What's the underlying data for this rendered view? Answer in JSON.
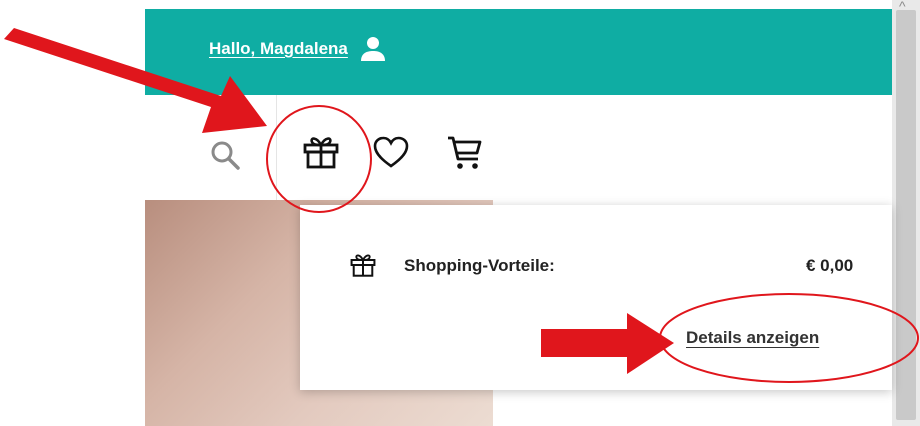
{
  "header": {
    "greeting": "Hallo, Magdalena",
    "user_icon": "user-icon",
    "background_color": "#0fada3"
  },
  "toolbar": {
    "icons": [
      "search-icon",
      "gift-icon",
      "heart-icon",
      "cart-icon"
    ]
  },
  "benefits_popup": {
    "icon": "gift-icon",
    "label": "Shopping-Vorteile:",
    "value": "€ 0,00",
    "details_link": "Details anzeigen"
  },
  "annotations": {
    "color": "#e0161c",
    "arrows": 2,
    "circles": 2
  }
}
